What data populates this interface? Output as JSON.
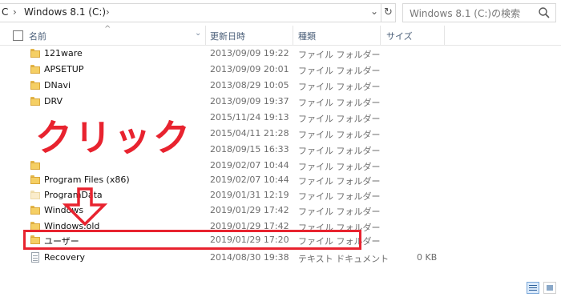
{
  "address_bar": {
    "root_fragment": "C",
    "crumb": "Windows 8.1 (C:)",
    "refresh_icon": "refresh-icon",
    "dropdown_icon": "chevron-down-icon"
  },
  "search": {
    "placeholder": "Windows 8.1 (C:)の検索",
    "icon": "search-icon"
  },
  "columns": {
    "name": "名前",
    "date": "更新日時",
    "type": "種類",
    "size": "サイズ"
  },
  "files": [
    {
      "name": "121ware",
      "date": "2013/09/09 19:22",
      "type": "ファイル フォルダー",
      "size": "",
      "icon": "folder-icon"
    },
    {
      "name": "APSETUP",
      "date": "2013/09/09 20:01",
      "type": "ファイル フォルダー",
      "size": "",
      "icon": "folder-icon"
    },
    {
      "name": "DNavi",
      "date": "2013/08/29 10:05",
      "type": "ファイル フォルダー",
      "size": "",
      "icon": "folder-icon"
    },
    {
      "name": "DRV",
      "date": "2013/09/09 19:37",
      "type": "ファイル フォルダー",
      "size": "",
      "icon": "folder-icon"
    },
    {
      "name": "",
      "date": "2015/11/24 19:13",
      "type": "ファイル フォルダー",
      "size": "",
      "icon": "folder-icon"
    },
    {
      "name": "",
      "date": "2015/04/11 21:28",
      "type": "ファイル フォルダー",
      "size": "",
      "icon": "folder-icon"
    },
    {
      "name": "",
      "date": "2018/09/15 16:33",
      "type": "ファイル フォルダー",
      "size": "",
      "icon": "folder-icon"
    },
    {
      "name": "",
      "date": "2019/02/07 10:44",
      "type": "ファイル フォルダー",
      "size": "",
      "icon": "folder-icon"
    },
    {
      "name": "Program Files (x86)",
      "date": "2019/02/07 10:44",
      "type": "ファイル フォルダー",
      "size": "",
      "icon": "folder-icon"
    },
    {
      "name": "ProgramData",
      "date": "2019/01/31 12:19",
      "type": "ファイル フォルダー",
      "size": "",
      "icon": "folder-icon"
    },
    {
      "name": "Windows",
      "date": "2019/01/29 17:42",
      "type": "ファイル フォルダー",
      "size": "",
      "icon": "folder-icon"
    },
    {
      "name": "Windows.old",
      "date": "2019/01/29 17:42",
      "type": "ファイル フォルダー",
      "size": "",
      "icon": "folder-icon"
    },
    {
      "name": "ユーザー",
      "date": "2019/01/29 17:20",
      "type": "ファイル フォルダー",
      "size": "",
      "icon": "folder-icon"
    },
    {
      "name": "Recovery",
      "date": "2014/08/30 19:38",
      "type": "テキスト ドキュメント",
      "size": "0 KB",
      "icon": "text-document-icon"
    }
  ],
  "annotation": {
    "label": "クリック",
    "color": "#e8232f",
    "arrow_icon": "down-arrow-icon"
  },
  "view_buttons": {
    "details_icon": "details-view-icon",
    "large_icon": "large-icons-view-icon"
  },
  "colors": {
    "header_text": "#4c607a",
    "annotation_red": "#e8232f",
    "folder_yellow": "#f5cf64"
  }
}
